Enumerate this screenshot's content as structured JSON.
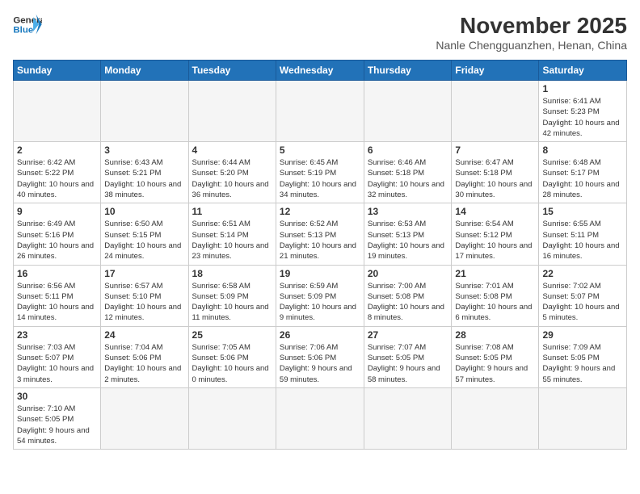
{
  "header": {
    "logo_general": "General",
    "logo_blue": "Blue",
    "month": "November 2025",
    "location": "Nanle Chengguanzhen, Henan, China"
  },
  "weekdays": [
    "Sunday",
    "Monday",
    "Tuesday",
    "Wednesday",
    "Thursday",
    "Friday",
    "Saturday"
  ],
  "days": {
    "1": {
      "sunrise": "6:41 AM",
      "sunset": "5:23 PM",
      "daylight": "10 hours and 42 minutes."
    },
    "2": {
      "sunrise": "6:42 AM",
      "sunset": "5:22 PM",
      "daylight": "10 hours and 40 minutes."
    },
    "3": {
      "sunrise": "6:43 AM",
      "sunset": "5:21 PM",
      "daylight": "10 hours and 38 minutes."
    },
    "4": {
      "sunrise": "6:44 AM",
      "sunset": "5:20 PM",
      "daylight": "10 hours and 36 minutes."
    },
    "5": {
      "sunrise": "6:45 AM",
      "sunset": "5:19 PM",
      "daylight": "10 hours and 34 minutes."
    },
    "6": {
      "sunrise": "6:46 AM",
      "sunset": "5:18 PM",
      "daylight": "10 hours and 32 minutes."
    },
    "7": {
      "sunrise": "6:47 AM",
      "sunset": "5:18 PM",
      "daylight": "10 hours and 30 minutes."
    },
    "8": {
      "sunrise": "6:48 AM",
      "sunset": "5:17 PM",
      "daylight": "10 hours and 28 minutes."
    },
    "9": {
      "sunrise": "6:49 AM",
      "sunset": "5:16 PM",
      "daylight": "10 hours and 26 minutes."
    },
    "10": {
      "sunrise": "6:50 AM",
      "sunset": "5:15 PM",
      "daylight": "10 hours and 24 minutes."
    },
    "11": {
      "sunrise": "6:51 AM",
      "sunset": "5:14 PM",
      "daylight": "10 hours and 23 minutes."
    },
    "12": {
      "sunrise": "6:52 AM",
      "sunset": "5:13 PM",
      "daylight": "10 hours and 21 minutes."
    },
    "13": {
      "sunrise": "6:53 AM",
      "sunset": "5:13 PM",
      "daylight": "10 hours and 19 minutes."
    },
    "14": {
      "sunrise": "6:54 AM",
      "sunset": "5:12 PM",
      "daylight": "10 hours and 17 minutes."
    },
    "15": {
      "sunrise": "6:55 AM",
      "sunset": "5:11 PM",
      "daylight": "10 hours and 16 minutes."
    },
    "16": {
      "sunrise": "6:56 AM",
      "sunset": "5:11 PM",
      "daylight": "10 hours and 14 minutes."
    },
    "17": {
      "sunrise": "6:57 AM",
      "sunset": "5:10 PM",
      "daylight": "10 hours and 12 minutes."
    },
    "18": {
      "sunrise": "6:58 AM",
      "sunset": "5:09 PM",
      "daylight": "10 hours and 11 minutes."
    },
    "19": {
      "sunrise": "6:59 AM",
      "sunset": "5:09 PM",
      "daylight": "10 hours and 9 minutes."
    },
    "20": {
      "sunrise": "7:00 AM",
      "sunset": "5:08 PM",
      "daylight": "10 hours and 8 minutes."
    },
    "21": {
      "sunrise": "7:01 AM",
      "sunset": "5:08 PM",
      "daylight": "10 hours and 6 minutes."
    },
    "22": {
      "sunrise": "7:02 AM",
      "sunset": "5:07 PM",
      "daylight": "10 hours and 5 minutes."
    },
    "23": {
      "sunrise": "7:03 AM",
      "sunset": "5:07 PM",
      "daylight": "10 hours and 3 minutes."
    },
    "24": {
      "sunrise": "7:04 AM",
      "sunset": "5:06 PM",
      "daylight": "10 hours and 2 minutes."
    },
    "25": {
      "sunrise": "7:05 AM",
      "sunset": "5:06 PM",
      "daylight": "10 hours and 0 minutes."
    },
    "26": {
      "sunrise": "7:06 AM",
      "sunset": "5:06 PM",
      "daylight": "9 hours and 59 minutes."
    },
    "27": {
      "sunrise": "7:07 AM",
      "sunset": "5:05 PM",
      "daylight": "9 hours and 58 minutes."
    },
    "28": {
      "sunrise": "7:08 AM",
      "sunset": "5:05 PM",
      "daylight": "9 hours and 57 minutes."
    },
    "29": {
      "sunrise": "7:09 AM",
      "sunset": "5:05 PM",
      "daylight": "9 hours and 55 minutes."
    },
    "30": {
      "sunrise": "7:10 AM",
      "sunset": "5:05 PM",
      "daylight": "9 hours and 54 minutes."
    }
  }
}
